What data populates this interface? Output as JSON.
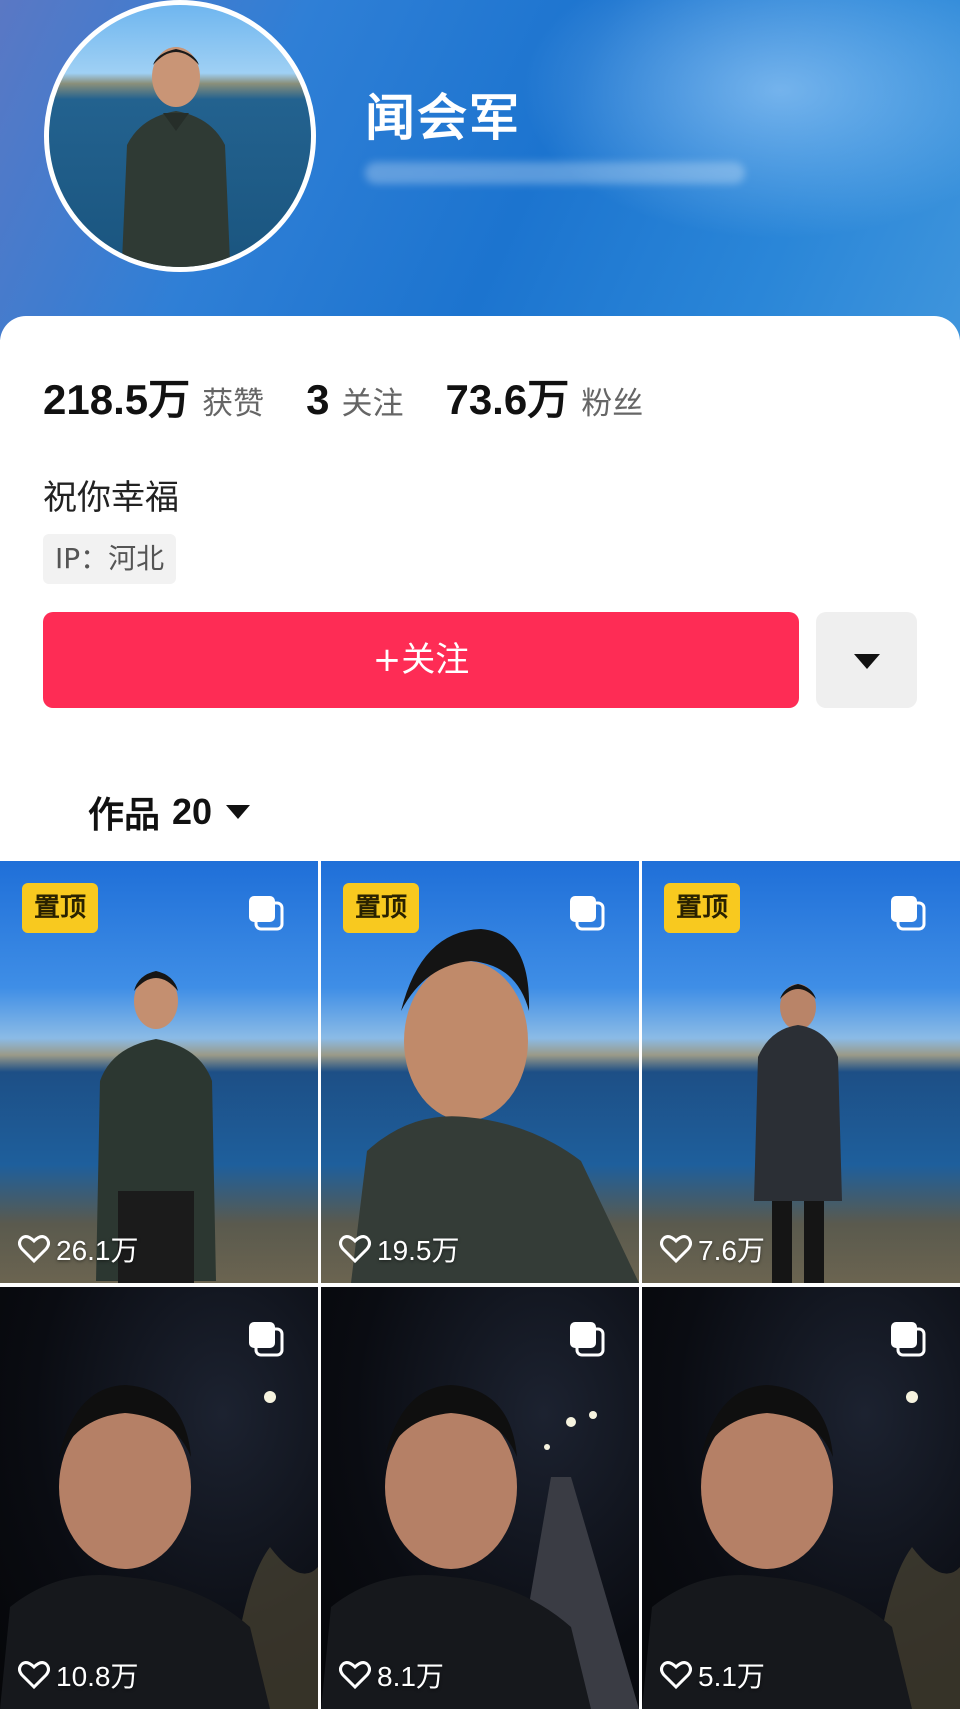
{
  "profile": {
    "name": "闻会军",
    "bio": "祝你幸福",
    "ip": "IP：河北"
  },
  "stats": [
    {
      "value": "218.5万",
      "label": "获赞"
    },
    {
      "value": "3",
      "label": "关注"
    },
    {
      "value": "73.6万",
      "label": "粉丝"
    }
  ],
  "actions": {
    "follow_label": "+关注",
    "more_icon": "caret-down-icon"
  },
  "works_tab": {
    "label": "作品",
    "count": "20"
  },
  "colors": {
    "follow_button": "#fe2c55",
    "pin_badge": "#f8c91f",
    "header_blue": "#1c74cf"
  },
  "videos": [
    {
      "likes": "26.1万",
      "pinned": true,
      "badge": "置顶",
      "scene": "day"
    },
    {
      "likes": "19.5万",
      "pinned": true,
      "badge": "置顶",
      "scene": "day"
    },
    {
      "likes": "7.6万",
      "pinned": true,
      "badge": "置顶",
      "scene": "day"
    },
    {
      "likes": "10.8万",
      "pinned": false,
      "scene": "night"
    },
    {
      "likes": "8.1万",
      "pinned": false,
      "scene": "night"
    },
    {
      "likes": "5.1万",
      "pinned": false,
      "scene": "night"
    }
  ]
}
